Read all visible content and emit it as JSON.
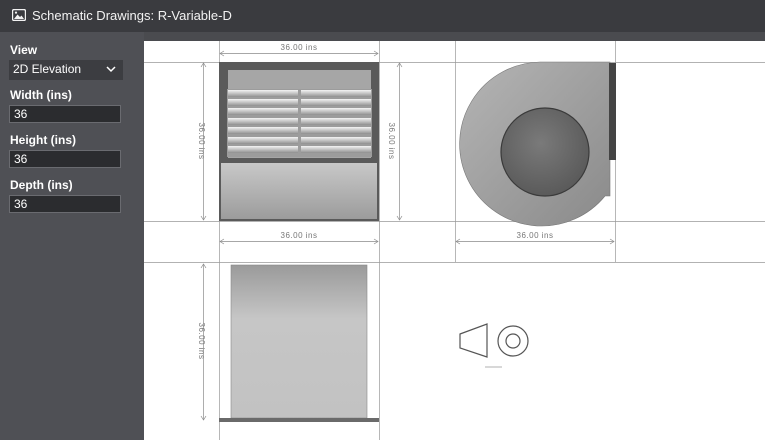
{
  "window": {
    "title": "Schematic Drawings: R-Variable-D"
  },
  "sidebar": {
    "view_label": "View",
    "view_value": "2D Elevation",
    "width_label": "Width (ins)",
    "width_value": "36",
    "height_label": "Height (ins)",
    "height_value": "36",
    "depth_label": "Depth (ins)",
    "depth_value": "36"
  },
  "drawing": {
    "dim_front_top": "36.00 ins",
    "dim_front_left": "36.00 ins",
    "dim_front_right": "36.00 ins",
    "dim_front_bottom": "36.00 ins",
    "dim_side_bottom": "36.00 ins",
    "dim_back_left": "36.00 ins"
  },
  "icons": {
    "title_icon": "image-icon",
    "dropdown_icon": "chevron-down-icon"
  },
  "colors": {
    "panel_bg": "#4f5055",
    "titlebar_bg": "#3a3b3f",
    "canvas_bg": "#ffffff"
  }
}
